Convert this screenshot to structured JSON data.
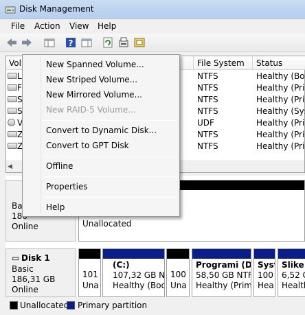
{
  "window": {
    "title": "Disk Management"
  },
  "menu": [
    "File",
    "Action",
    "View",
    "Help"
  ],
  "toolbar": {
    "icons": [
      "back-arrow-icon",
      "forward-arrow-icon",
      "console-tree-icon",
      "help-icon",
      "properties-icon",
      "refresh-icon",
      "rescan-icon",
      "wizard-icon"
    ]
  },
  "volume_list": {
    "columns": [
      "Volume",
      "File System",
      "Status"
    ],
    "rows": [
      {
        "fs": "NTFS",
        "status": "Healthy (Boot"
      },
      {
        "fs": "NTFS",
        "status": "Healthy (Prim"
      },
      {
        "fs": "NTFS",
        "status": "Healthy (Prim"
      },
      {
        "fs": "NTFS",
        "status": "Healthy (Syste"
      },
      {
        "fs": "UDF",
        "status": "Healthy (Prim"
      },
      {
        "fs": "NTFS",
        "status": "Healthy (Prim"
      },
      {
        "fs": "NTFS",
        "status": "Healthy (Prim"
      }
    ],
    "partial_volume_letters": [
      "L",
      "F",
      "S",
      "S",
      "V",
      "Z",
      "Z"
    ]
  },
  "context_menu": {
    "items": [
      {
        "label": "New Spanned Volume...",
        "enabled": true
      },
      {
        "label": "New Striped Volume...",
        "enabled": true
      },
      {
        "label": "New Mirrored Volume...",
        "enabled": true
      },
      {
        "label": "New RAID-5 Volume...",
        "enabled": false
      },
      {
        "label": "Convert to Dynamic Disk...",
        "enabled": true
      },
      {
        "label": "Convert to GPT Disk",
        "enabled": true
      },
      {
        "label": "Offline",
        "enabled": true
      },
      {
        "label": "Properties",
        "enabled": true
      },
      {
        "label": "Help",
        "enabled": true
      }
    ]
  },
  "disk0": {
    "type_partial": "Basi",
    "size_partial": "186",
    "status": "Online",
    "partition_label": "Unallocated"
  },
  "disk1": {
    "name": "Disk 1",
    "type": "Basic",
    "size": "186,31 GB",
    "status": "Online",
    "partitions": [
      {
        "line1": "101",
        "line2": "Una",
        "bar_color": "#000000"
      },
      {
        "title": "(C:)",
        "line1": "107,32 GB NTF",
        "line2": "Healthy (Boot,",
        "bar_color": "#0a1e8a"
      },
      {
        "line1": "100",
        "line2": "Una",
        "bar_color": "#000000"
      },
      {
        "title": "Programi  (D:",
        "line1": "58,50 GB NTFS",
        "line2": "Healthy (Prim",
        "bar_color": "#0a1e8a"
      },
      {
        "title": "Syst",
        "line1": "100",
        "line2": "Hea",
        "bar_color": "#0a1e8a"
      },
      {
        "title": "Slike",
        "line1": "6,52 G",
        "line2": "Health",
        "bar_color": "#0a1e8a"
      }
    ]
  },
  "legend": [
    {
      "label": "Unallocated",
      "color": "#000000"
    },
    {
      "label": "Primary partition",
      "color": "#0a1e8a"
    }
  ]
}
